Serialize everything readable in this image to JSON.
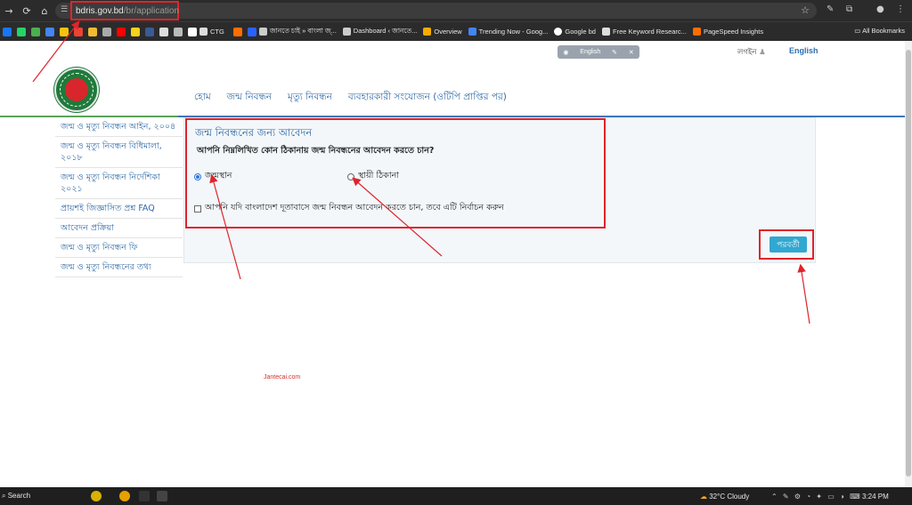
{
  "browser": {
    "url_host": "bdris.gov.bd",
    "url_path": "/br/application",
    "bookmarks": [
      "জানতে চাই » বাংলা জ্...",
      "Dashboard ‹ জানতে...",
      "Overview",
      "Trending Now - Goog...",
      "Google bd",
      "Free Keyword Researc...",
      "PageSpeed Insights"
    ],
    "bookmark_ctg": "CTG",
    "all_bookmarks": "All Bookmarks"
  },
  "header": {
    "lang_pill": "English",
    "login": "লগইন",
    "english_link": "English",
    "menu": [
      "হোম",
      "জন্ম নিবন্ধন",
      "মৃত্যু নিবন্ধন",
      "ব্যবহারকারী সংযোজন (ওটিপি প্রাপ্তির পর)"
    ]
  },
  "sidebar": {
    "items": [
      "জন্ম ও মৃত্যু নিবন্ধন আইন, ২০০৪",
      "জন্ম ও মৃত্যু নিবন্ধন বিধিমালা, ২০১৮",
      "জন্ম ও মৃত্যু নিবন্ধন নির্দেশিকা ২০২১",
      "প্রায়শই জিজ্ঞাসিত প্রশ্ন FAQ",
      "আবেদন প্রক্রিয়া",
      "জন্ম ও মৃত্যু নিবন্ধন ফি",
      "জন্ম ও মৃত্যু নিবন্ধনের তথ্য"
    ]
  },
  "form": {
    "title": "জন্ম নিবন্ধনের জন্য আবেদন",
    "question": "আপনি নিম্নলিখিত কোন ঠিকানায় জন্ম নিবন্ধনের আবেদন করতে চান?",
    "option_birthplace": "জন্মস্থান",
    "option_permanent": "স্থায়ী ঠিকানা",
    "selected": "জন্মস্থান",
    "embassy_checkbox": "আপনি যদি বাংলাদেশ দূতাবাসে জন্ম নিবন্ধন আবেদন করতে চান, তবে এটি নির্বাচন করুন",
    "next_button": "পরবর্তী"
  },
  "watermark": "Jantecai.com",
  "taskbar": {
    "search": "Search",
    "weather": "32°C  Cloudy",
    "time": "3:24 PM"
  },
  "colors": {
    "accent_blue": "#2f6aa6",
    "annotation_red": "#e0242b",
    "next_button": "#31a8d1"
  }
}
